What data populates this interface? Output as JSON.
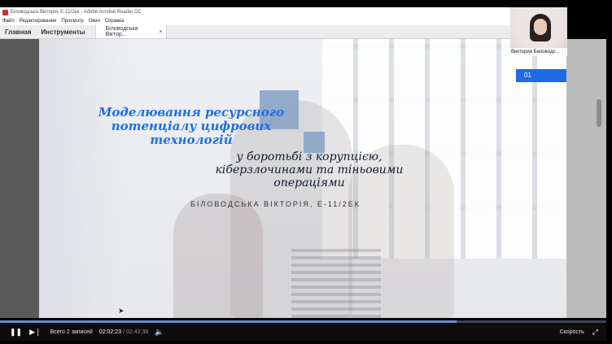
{
  "window": {
    "title": "Біловодська Вікторія, Е-11/2ек - Adobe Acrobat Reader DC"
  },
  "menu": [
    "Файл",
    "Редактирование",
    "Просмотр",
    "Окно",
    "Справка"
  ],
  "tabs": {
    "home": "Главная",
    "tools": "Инструменты",
    "document": "Біловодська Віктор...",
    "close": "×"
  },
  "slide": {
    "title": "Моделювання ресурсного потенціалу цифрових технологій",
    "subtitle": "у боротьбі з корупцією, кіберзлочинами та тіньовими операціями",
    "author": "БІЛОВОДСЬКА ВІКТОРІЯ, Е-11/2ЕК"
  },
  "webcam": {
    "name": "Виктория Беловодс..."
  },
  "page_indicator": "01",
  "player": {
    "records": "Всего 2 записей",
    "current_time": "02:02:23",
    "separator": "/",
    "total_time": "02:42:36",
    "speed_label": "Скорость",
    "progress": 0.753,
    "icons": {
      "play_pause": "pause-icon",
      "next": "skip-next-icon",
      "volume": "volume-icon",
      "fullscreen": "fullscreen-icon"
    }
  },
  "colors": {
    "accent_blue": "#1e6be6",
    "title_blue": "#1f6fe0",
    "square_blue": "#8fa8c8"
  }
}
